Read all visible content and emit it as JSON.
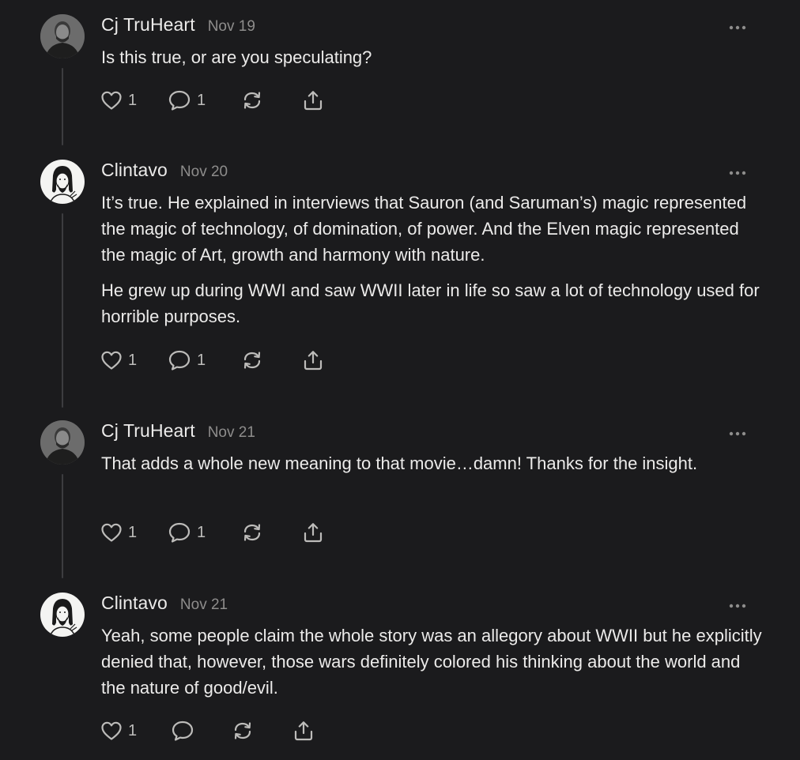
{
  "comments": [
    {
      "author": "Cj TruHeart",
      "avatar": "photo-avatar-icon",
      "date": "Nov 19",
      "paragraphs": [
        "Is this true, or are you speculating?"
      ],
      "likes": "1",
      "replies": "1"
    },
    {
      "author": "Clintavo",
      "avatar": "sketch-avatar-icon",
      "date": "Nov 20",
      "paragraphs": [
        "It’s true. He explained in interviews that Sauron (and Saruman’s) magic represented the magic of technology, of domination, of power. And the Elven magic represented the magic of Art, growth and harmony with nature.",
        "He grew up during WWI and saw WWII later in life so saw a lot of technology used for horrible purposes."
      ],
      "likes": "1",
      "replies": "1"
    },
    {
      "author": "Cj TruHeart",
      "avatar": "photo-avatar-icon",
      "date": "Nov 21",
      "paragraphs": [
        "That adds a whole new meaning to that movie…damn! Thanks for the insight."
      ],
      "likes": "1",
      "replies": "1"
    },
    {
      "author": "Clintavo",
      "avatar": "sketch-avatar-icon",
      "date": "Nov 21",
      "paragraphs": [
        "Yeah, some people claim the whole story was an allegory about WWII but he explicitly denied that, however, those wars definitely colored his thinking about the world and the nature of good/evil."
      ],
      "likes": "1",
      "replies": ""
    }
  ],
  "icons": {
    "like": "heart-icon",
    "reply": "speech-bubble-icon",
    "restack": "restack-arrows-icon",
    "share": "share-upload-icon",
    "more": "more-dots-icon"
  },
  "colors": {
    "background": "#1b1b1d",
    "text": "#ecebea",
    "muted": "#8e8d8c",
    "icon": "#bdbcba",
    "thread_line": "#3d3d40"
  }
}
